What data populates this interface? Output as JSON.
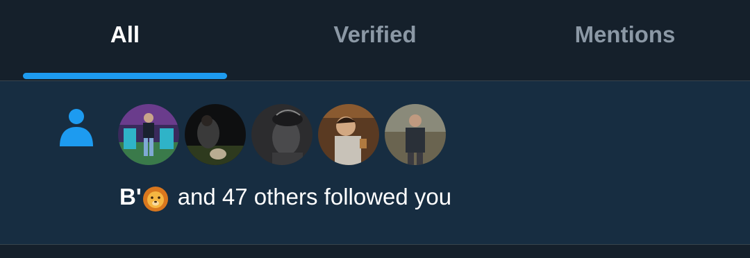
{
  "tabs": [
    {
      "label": "All",
      "active": true
    },
    {
      "label": "Verified",
      "active": false
    },
    {
      "label": "Mentions",
      "active": false
    }
  ],
  "notification": {
    "icon": "person-icon",
    "avatars": [
      {
        "name": "follower-avatar-1"
      },
      {
        "name": "follower-avatar-2"
      },
      {
        "name": "follower-avatar-3"
      },
      {
        "name": "follower-avatar-4"
      },
      {
        "name": "follower-avatar-5"
      }
    ],
    "user_name": "B'",
    "emoji": "lion-face-emoji",
    "message": "and 47 others followed you"
  },
  "colors": {
    "background": "#15202b",
    "row_background": "#172d41",
    "accent": "#1d9bf0",
    "tab_inactive": "#8b98a5",
    "text": "#ffffff"
  }
}
